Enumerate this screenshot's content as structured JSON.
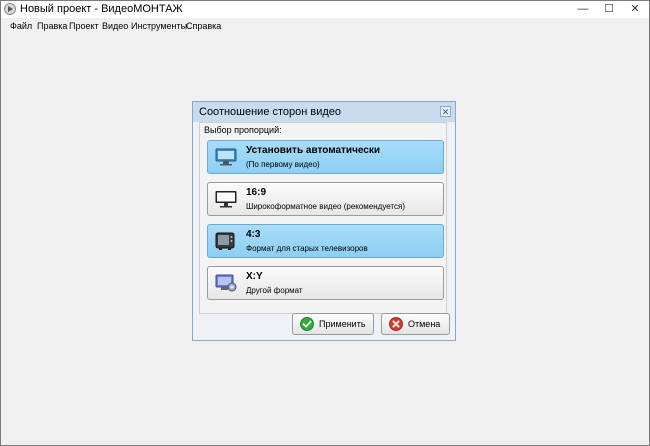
{
  "window": {
    "title": "Новый проект - ВидеоМОНТАЖ",
    "controls": {
      "minimize": "—",
      "maximize": "☐",
      "close": "✕"
    }
  },
  "menu": [
    "Файл",
    "Правка",
    "Проект",
    "Видео",
    "Инструменты",
    "Справка"
  ],
  "dialog": {
    "title": "Соотношение сторон видео",
    "close": "✕",
    "prompt": "Выбор пропорций:",
    "options": [
      {
        "title": "Установить автоматически",
        "subtitle": "(По первому видео)",
        "icon": "monitor-auto-icon",
        "selected": true
      },
      {
        "title": "16:9",
        "subtitle": "Широкоформатное видео (рекомендуется)",
        "icon": "widescreen-monitor-icon",
        "selected": false
      },
      {
        "title": "4:3",
        "subtitle": "Формат для старых телевизоров",
        "icon": "old-tv-icon",
        "selected": true
      },
      {
        "title": "X:Y",
        "subtitle": "Другой формат",
        "icon": "custom-format-icon",
        "selected": false
      }
    ],
    "apply": "Применить",
    "cancel": "Отмена"
  },
  "colors": {
    "selected_fill": "#8ccff4",
    "dialog_title": "#c8dbef",
    "apply_icon": "#2fae3a",
    "cancel_icon": "#d93a2f"
  }
}
